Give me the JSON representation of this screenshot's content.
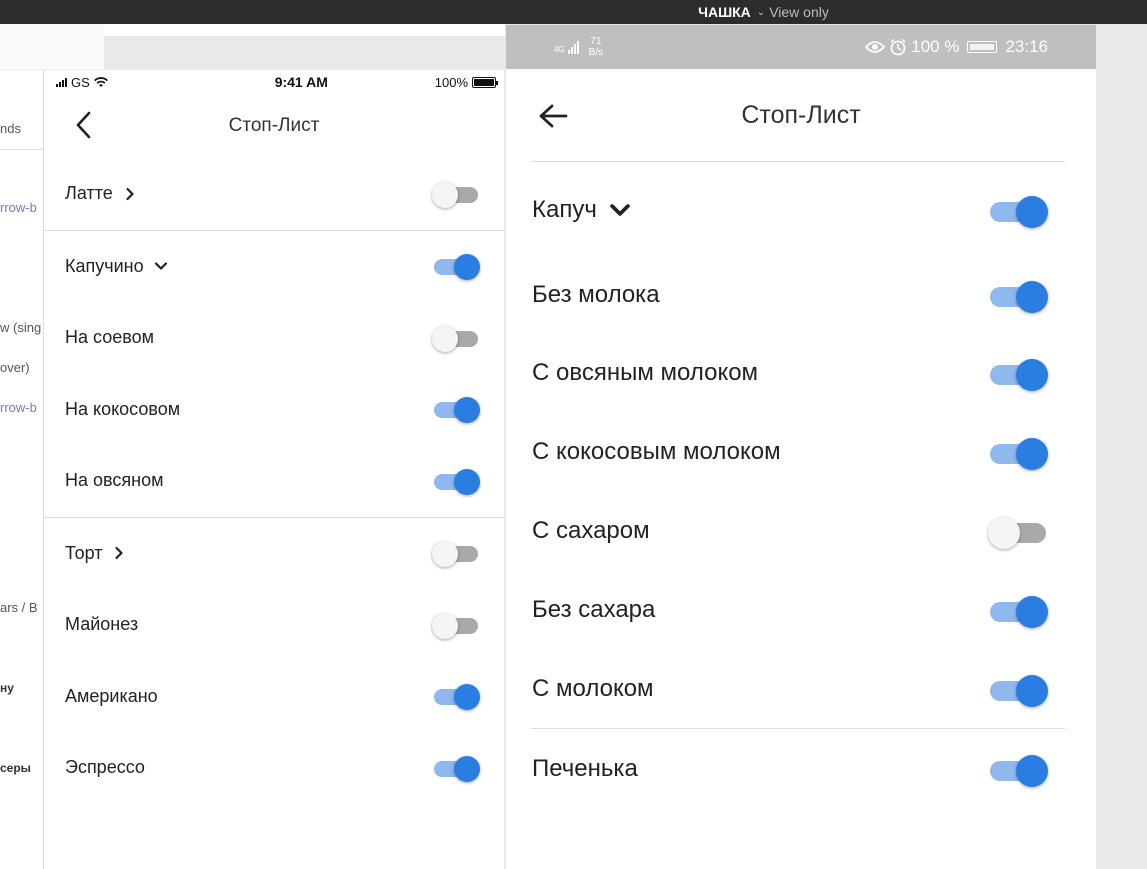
{
  "topbar": {
    "file_name": "ЧАШКА",
    "mode": "View only"
  },
  "sidebar_fragments": [
    "nds",
    "rrow-b",
    "w (sing",
    "over)",
    "rrow-b",
    "ars / B",
    "ну",
    "серы"
  ],
  "colors": {
    "toggle_on_knob": "#2a7de1",
    "toggle_on_track": "#8fb8ef",
    "toggle_off_track": "#a9a9a9",
    "android_status": "#bfbfbf"
  },
  "ios": {
    "status": {
      "carrier": "GS",
      "time": "9:41 AM",
      "battery": "100%"
    },
    "title": "Стоп-Лист",
    "back_icon": "chevron-left-icon",
    "groups": [
      {
        "items": [
          {
            "label": "Латте",
            "chevron": "chevron-right-icon",
            "on": false
          }
        ]
      },
      {
        "items": [
          {
            "label": "Капучино",
            "chevron": "chevron-down-icon",
            "on": true
          },
          {
            "label": "На соевом",
            "on": false
          },
          {
            "label": "На кокосовом",
            "on": true
          },
          {
            "label": "На овсяном",
            "on": true
          }
        ]
      },
      {
        "items": [
          {
            "label": "Торт",
            "chevron": "chevron-right-icon",
            "on": false
          },
          {
            "label": "Майонез",
            "on": false
          },
          {
            "label": "Американо",
            "on": true
          },
          {
            "label": "Эспрессо",
            "on": true
          }
        ]
      }
    ]
  },
  "android": {
    "status": {
      "network": "4G",
      "speed_value": "71",
      "speed_unit": "B/s",
      "battery": "100 %",
      "time": "23:16"
    },
    "title": "Стоп-Лист",
    "back_icon": "arrow-left-icon",
    "groups": [
      {
        "items": [
          {
            "label": "Капуч",
            "chevron": "chevron-down-icon",
            "on": true
          },
          {
            "label": "Без молока",
            "on": true
          },
          {
            "label": "С овсяным молоком",
            "on": true
          },
          {
            "label": "С кокосовым молоком",
            "on": true
          },
          {
            "label": "С сахаром",
            "on": false
          },
          {
            "label": "Без сахара",
            "on": true
          },
          {
            "label": "С молоком",
            "on": true
          }
        ]
      },
      {
        "items": [
          {
            "label": "Печенька",
            "on": true
          }
        ]
      }
    ]
  }
}
